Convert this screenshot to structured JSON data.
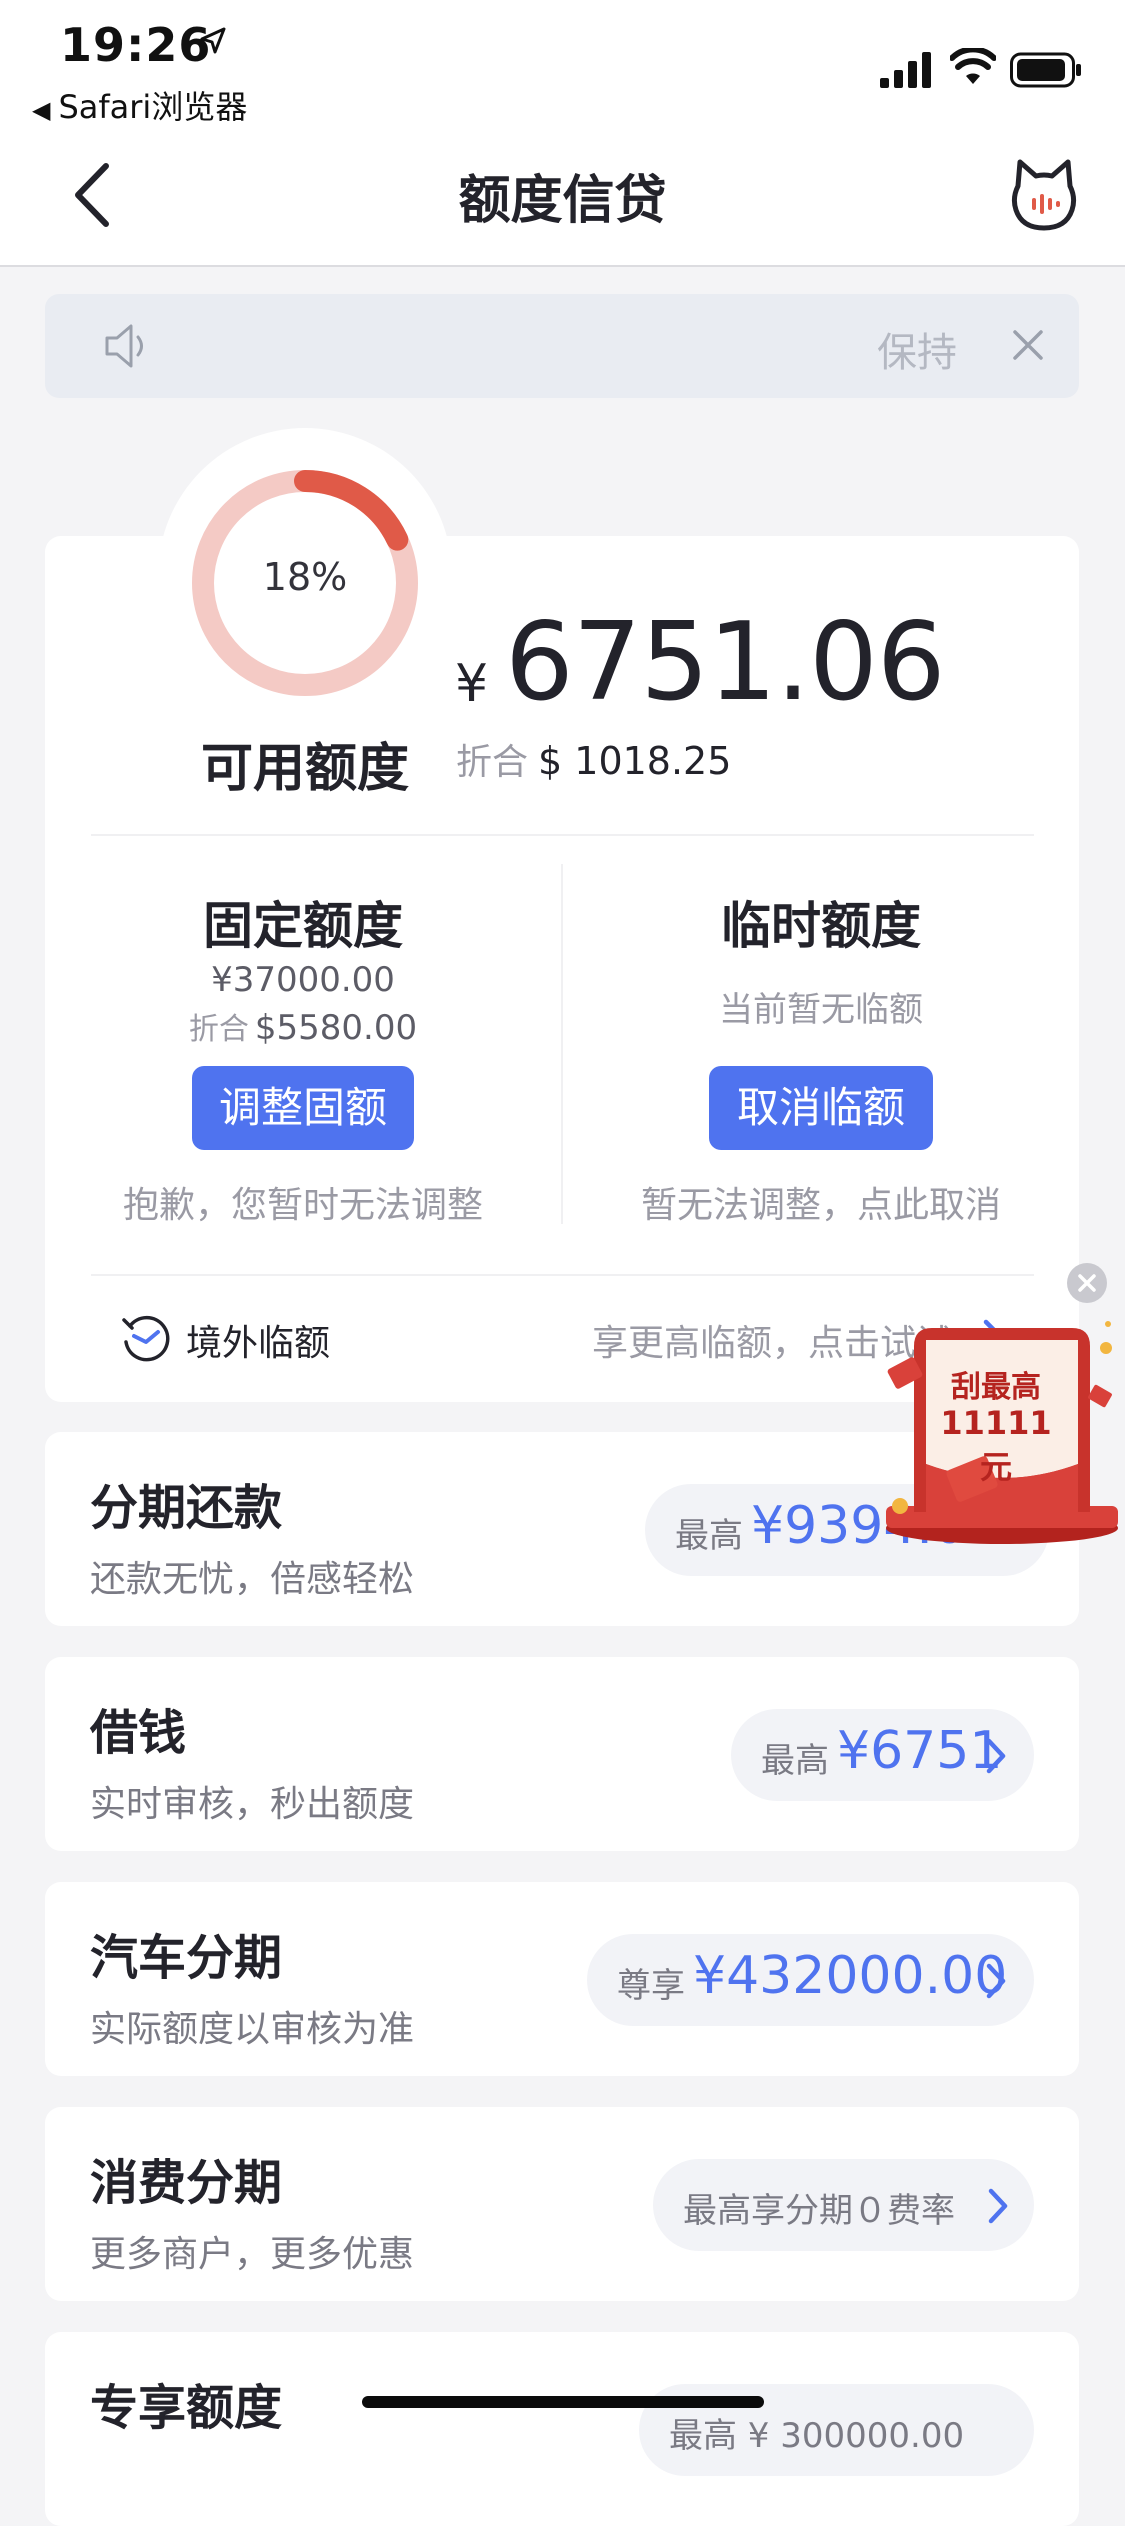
{
  "status_bar": {
    "time": "19:26",
    "back_app": "Safari浏览器"
  },
  "nav": {
    "title": "额度信贷"
  },
  "notice": {
    "text": "保持"
  },
  "credit": {
    "percent": "18%",
    "percent_value": 0.18,
    "available_label": "可用额度",
    "currency_symbol": "¥",
    "amount": "6751.06",
    "converted_label": "折合",
    "converted_amount": "$ 1018.25"
  },
  "fixed": {
    "title": "固定额度",
    "amount": "¥37000.00",
    "converted_label": "折合",
    "converted_amount": "$5580.00",
    "button": "调整固额",
    "note": "抱歉，您暂时无法调整"
  },
  "temporary": {
    "title": "临时额度",
    "status": "当前暂无临额",
    "button": "取消临额",
    "note": "暂无法调整，点此取消"
  },
  "overseas": {
    "label": "境外临额",
    "hint": "享更高临额，点击试试"
  },
  "promo": {
    "line1": "刮最高",
    "line2": "11111元"
  },
  "items": [
    {
      "title": "分期还款",
      "subtitle": "还款无忧，倍感轻松",
      "pill_label": "最高",
      "pill_value": "¥9394.00"
    },
    {
      "title": "借钱",
      "subtitle": "实时审核，秒出额度",
      "pill_label": "最高",
      "pill_value": "¥6751"
    },
    {
      "title": "汽车分期",
      "subtitle": "实际额度以审核为准",
      "pill_label": "尊享",
      "pill_value": "¥432000.00"
    },
    {
      "title": "消费分期",
      "subtitle": "更多商户，更多优惠",
      "pill_label": "最高享分期０费率",
      "pill_value": ""
    },
    {
      "title": "专享额度",
      "subtitle": "",
      "pill_label": "最高 ¥ 300000.00",
      "pill_value": ""
    }
  ],
  "colors": {
    "accent": "#4f73ef",
    "ring_bg": "#f4cac5",
    "ring_fg": "#e05a48",
    "promo_red": "#c8332c"
  }
}
